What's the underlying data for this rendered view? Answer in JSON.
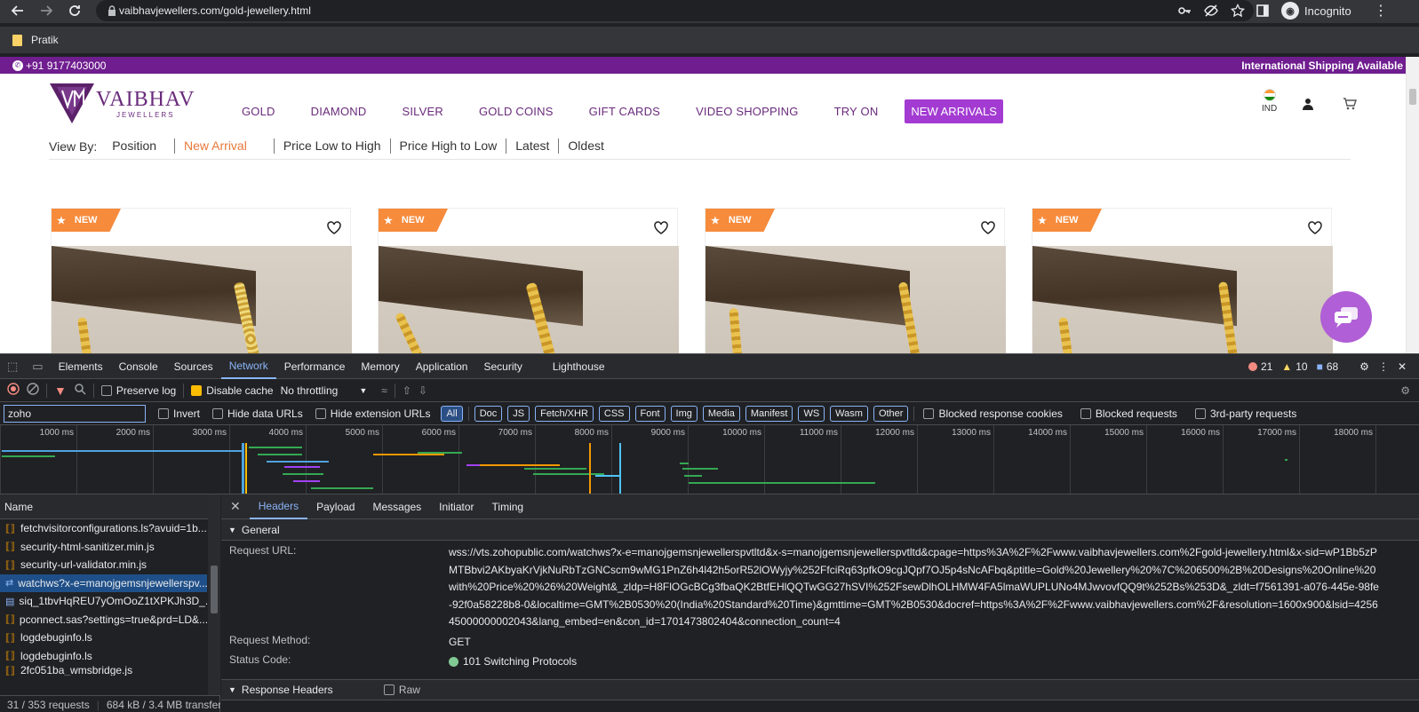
{
  "browser": {
    "url_host": "vaibhavjewellers.com",
    "url_path": "/gold-jewellery.html",
    "profile": "Incognito",
    "bookmark": "Pratik"
  },
  "site": {
    "phone": "+91 9177403000",
    "shipping": "International Shipping Available",
    "logo_title": "VAIBHAV",
    "logo_sub": "JEWELLERS",
    "nav": [
      "GOLD",
      "DIAMOND",
      "SILVER",
      "GOLD COINS",
      "GIFT CARDS",
      "VIDEO SHOPPING",
      "TRY ON"
    ],
    "nav_highlight": "NEW ARRIVALS",
    "region": "IND",
    "sort_label": "View By:",
    "sort_options": [
      "Position",
      "New Arrival",
      "Price Low to High",
      "Price High to Low",
      "Latest",
      "Oldest"
    ],
    "ribbon": "NEW"
  },
  "devtools": {
    "tabs": [
      "Elements",
      "Console",
      "Sources",
      "Network",
      "Performance",
      "Memory",
      "Application",
      "Security",
      "Lighthouse"
    ],
    "errors": "21",
    "warnings": "10",
    "messages": "68",
    "toolbar": {
      "preserve_log": "Preserve log",
      "disable_cache": "Disable cache",
      "throttling": "No throttling"
    },
    "filter": {
      "value": "zoho",
      "invert": "Invert",
      "hide_data": "Hide data URLs",
      "hide_ext": "Hide extension URLs",
      "types": [
        "All",
        "Doc",
        "JS",
        "Fetch/XHR",
        "CSS",
        "Font",
        "Img",
        "Media",
        "Manifest",
        "WS",
        "Wasm",
        "Other"
      ],
      "blocked_cookies": "Blocked response cookies",
      "blocked_requests": "Blocked requests",
      "third_party": "3rd-party requests"
    },
    "timeline_ticks": [
      "1000 ms",
      "2000 ms",
      "3000 ms",
      "4000 ms",
      "5000 ms",
      "6000 ms",
      "7000 ms",
      "8000 ms",
      "9000 ms",
      "10000 ms",
      "11000 ms",
      "12000 ms",
      "13000 ms",
      "14000 ms",
      "15000 ms",
      "16000 ms",
      "17000 ms",
      "18000 ms"
    ],
    "name_header": "Name",
    "requests": [
      "fetchvisitorconfigurations.ls?avuid=1b...",
      "security-html-sanitizer.min.js",
      "security-url-validator.min.js",
      "watchws?x-e=manojgemsnjewellerspv...",
      "siq_1tbvHqREU7yOmOoZ1tXPKJh3D_...",
      "pconnect.sas?settings=true&prd=LD&...",
      "logdebuginfo.ls",
      "logdebuginfo.ls",
      "2fc051ba_wmsbridge.js"
    ],
    "request_count": "31 / 353 requests",
    "transfer": "684 kB / 3.4 MB transferr",
    "detail_tabs": [
      "Headers",
      "Payload",
      "Messages",
      "Initiator",
      "Timing"
    ],
    "general_title": "General",
    "request_url_label": "Request URL:",
    "request_url": "wss://vts.zohopublic.com/watchws?x-e=manojgemsnjewellerspvtltd&x-s=manojgemsnjewellerspvtltd&cpage=https%3A%2F%2Fwww.vaibhavjewellers.com%2Fgold-jewellery.html&x-sid=wP1Bb5zPMTBbvi2AKbyaKrVjkNuRbTzGNCscm9wMG1PnZ6h4l42h5orR52lOWyjy%252FfciRq63pfkO9cgJQpf7OJ5p4sNcAFbq&ptitle=Gold%20Jewellery%20%7C%206500%2B%20Designs%20Online%20with%20Price%20%26%20Weight&_zldp=H8FlOGcBCg3fbaQK2BtfEHlQQTwGG27hSVI%252FsewDlhOLHMW4FA5lmaWUPLUNo4MJwvovfQQ9t%252Bs%253D&_zldt=f7561391-a076-445e-98fe-92f0a58228b8-0&localtime=GMT%2B0530%20(India%20Standard%20Time)&gmttime=GMT%2B0530&docref=https%3A%2F%2Fwww.vaibhavjewellers.com%2F&resolution=1600x900&lsid=425645000000002043&lang_embed=en&con_id=1701473802404&connection_count=4",
    "request_method_label": "Request Method:",
    "request_method": "GET",
    "status_code_label": "Status Code:",
    "status_code": "101 Switching Protocols",
    "response_headers_title": "Response Headers",
    "raw_label": "Raw"
  }
}
